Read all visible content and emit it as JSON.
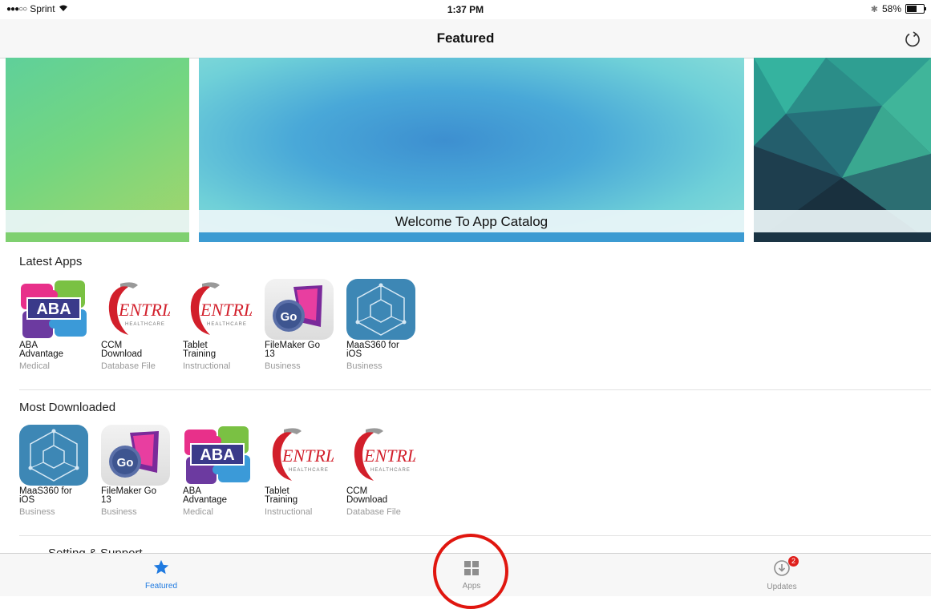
{
  "status_bar": {
    "carrier": "Sprint",
    "time": "1:37 PM",
    "battery_text": "58%",
    "battery_level": 0.58
  },
  "nav": {
    "title": "Featured"
  },
  "banners": [
    {
      "caption": ""
    },
    {
      "caption": "Welcome To App Catalog"
    },
    {
      "caption": ""
    }
  ],
  "latest_apps": {
    "title": "Latest Apps",
    "items": [
      {
        "name_line1": "ABA",
        "name_line2": "Advantage",
        "category": "Medical",
        "icon": "aba-puzzle-icon"
      },
      {
        "name_line1": "CCM",
        "name_line2": "Download",
        "category": "Database File",
        "icon": "centria-healthcare-icon"
      },
      {
        "name_line1": "Tablet",
        "name_line2": "Training",
        "category": "Instructional",
        "icon": "centria-healthcare-icon"
      },
      {
        "name_line1": "FileMaker Go",
        "name_line2": "13",
        "category": "Business",
        "icon": "filemaker-go-icon"
      },
      {
        "name_line1": "MaaS360 for",
        "name_line2": "iOS",
        "category": "Business",
        "icon": "maas360-icon"
      }
    ]
  },
  "most_downloaded": {
    "title": "Most Downloaded",
    "items": [
      {
        "name_line1": "MaaS360 for",
        "name_line2": "iOS",
        "category": "Business",
        "icon": "maas360-icon"
      },
      {
        "name_line1": "FileMaker Go",
        "name_line2": "13",
        "category": "Business",
        "icon": "filemaker-go-icon"
      },
      {
        "name_line1": "ABA",
        "name_line2": "Advantage",
        "category": "Medical",
        "icon": "aba-puzzle-icon"
      },
      {
        "name_line1": "Tablet",
        "name_line2": "Training",
        "category": "Instructional",
        "icon": "centria-healthcare-icon"
      },
      {
        "name_line1": "CCM",
        "name_line2": "Download",
        "category": "Database File",
        "icon": "centria-healthcare-icon"
      }
    ]
  },
  "peek_section": {
    "title": "Setting & Support"
  },
  "icon_text": {
    "aba": "ABA",
    "centria_main": "ENTRIA",
    "centria_sub": "HEALTHCARE",
    "fm_go": "Go"
  },
  "tab_bar": {
    "tabs": [
      {
        "label": "Featured",
        "icon": "star-icon",
        "active": true
      },
      {
        "label": "Apps",
        "icon": "grid-icon",
        "active": false
      },
      {
        "label": "Updates",
        "icon": "updates-icon",
        "active": false,
        "badge": "2"
      }
    ]
  },
  "colors": {
    "accent": "#1f7ae0",
    "annotation_circle": "#e0160f",
    "badge": "#e0201c"
  }
}
